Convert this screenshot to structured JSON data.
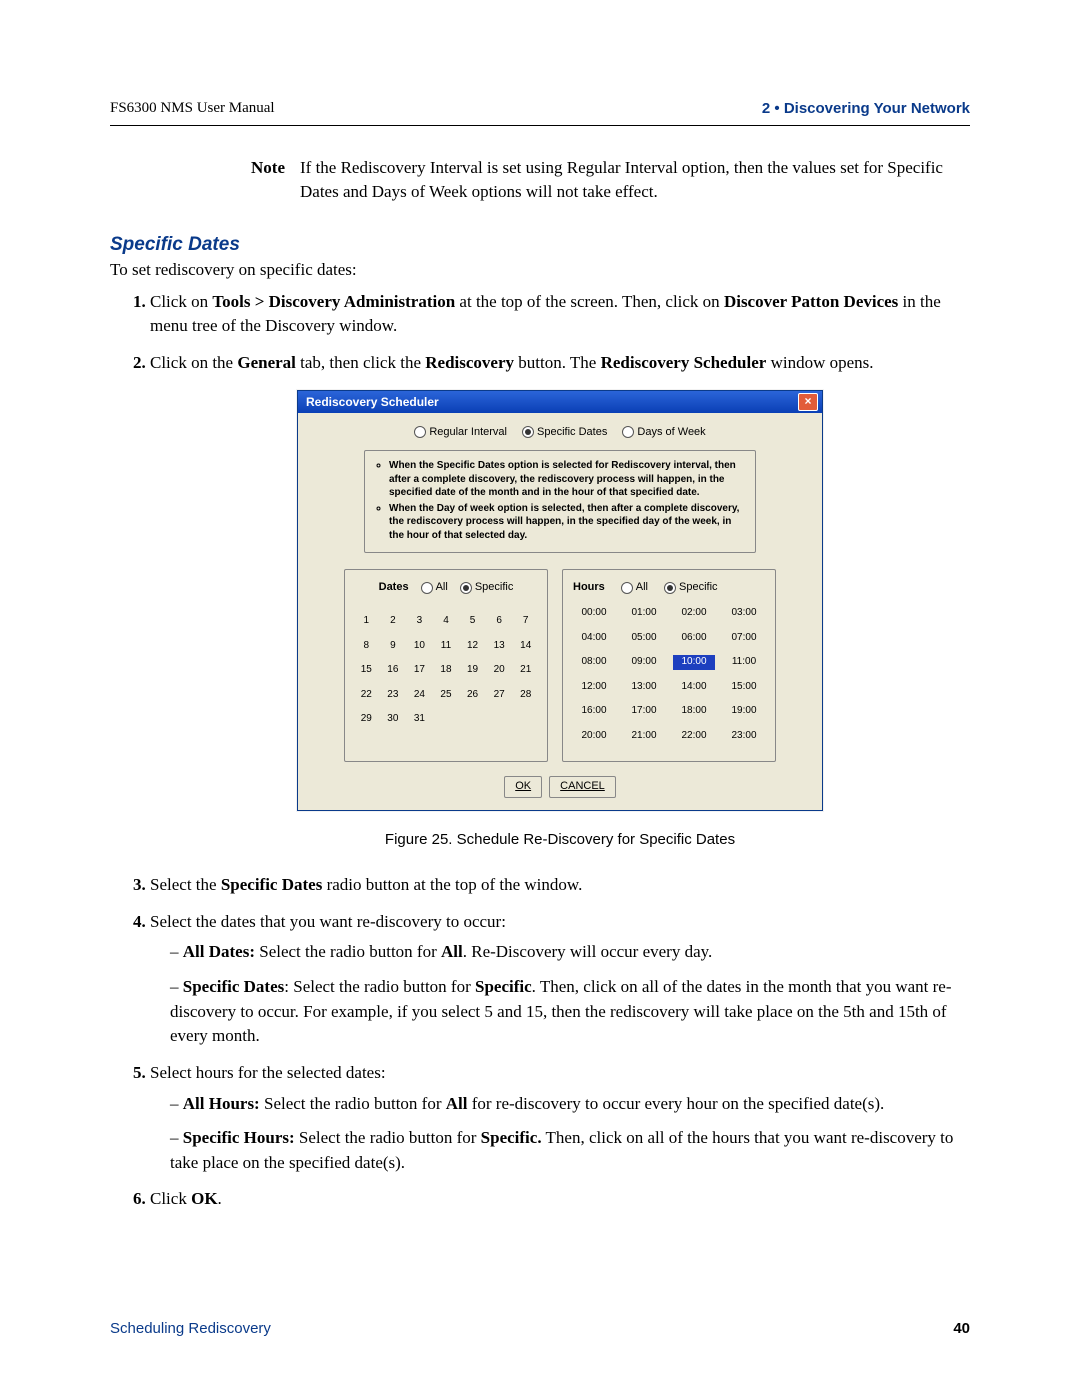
{
  "header": {
    "left": "FS6300 NMS User Manual",
    "right": "2 • Discovering Your Network"
  },
  "note": {
    "label": "Note",
    "text": "If the Rediscovery Interval is set using Regular Interval option, then the values set for Specific Dates and Days of Week options will not take effect."
  },
  "section_title": "Specific Dates",
  "intro": "To set rediscovery on specific dates:",
  "steps": {
    "s1_a": "Click on ",
    "s1_b": "Tools > Discovery Administration",
    "s1_c": " at the top of the screen. Then, click on ",
    "s1_d": "Discover Patton Devices",
    "s1_e": " in the menu tree of the Discovery window.",
    "s2_a": "Click on the ",
    "s2_b": "General",
    "s2_c": " tab, then click the ",
    "s2_d": "Rediscovery",
    "s2_e": " button. The ",
    "s2_f": "Rediscovery Scheduler",
    "s2_g": " window opens.",
    "s3_a": "Select the ",
    "s3_b": "Specific Dates",
    "s3_c": " radio button at the top of the window.",
    "s4": "Select the dates that you want re-discovery to occur:",
    "s4_all_a": "All Dates:",
    "s4_all_b": " Select the radio button for ",
    "s4_all_c": "All",
    "s4_all_d": ". Re-Discovery will occur every day.",
    "s4_sp_a": "Specific Dates",
    "s4_sp_b": ": Select the radio button for ",
    "s4_sp_c": "Specific",
    "s4_sp_d": ". Then, click on all of the dates in the month that you want re-discovery to occur. For example, if you select 5 and 15, then the rediscovery will take place on the 5th and 15th of every month.",
    "s5": "Select hours for the selected dates:",
    "s5_ah_a": "All Hours:",
    "s5_ah_b": " Select the radio button for ",
    "s5_ah_c": "All",
    "s5_ah_d": " for re-discovery to occur every hour on the specified date(s).",
    "s5_sh_a": "Specific Hours:",
    "s5_sh_b": " Select the radio button for ",
    "s5_sh_c": "Specific.",
    "s5_sh_d": " Then, click on all of the hours that you want re-discovery to take place on the specified date(s).",
    "s6_a": "Click ",
    "s6_b": "OK",
    "s6_c": "."
  },
  "figure_caption": "Figure 25. Schedule Re-Discovery for Specific Dates",
  "dialog": {
    "title": "Rediscovery Scheduler",
    "radios": {
      "regular": "Regular Interval",
      "specific": "Specific Dates",
      "days": "Days of Week"
    },
    "info1": "When the Specific Dates option is selected for Rediscovery interval, then after a complete discovery, the rediscovery process will happen, in the specified date of the month and in the hour of that specified date.",
    "info2": "When the Day of week option is selected, then after a complete discovery, the rediscovery process will happen, in the specified day of the week, in the hour of that selected day.",
    "dates_label": "Dates",
    "hours_label": "Hours",
    "all_label": "All",
    "specific_label": "Specific",
    "ok": "OK",
    "cancel": "CANCEL",
    "days": [
      "1",
      "2",
      "3",
      "4",
      "5",
      "6",
      "7",
      "8",
      "9",
      "10",
      "11",
      "12",
      "13",
      "14",
      "15",
      "16",
      "17",
      "18",
      "19",
      "20",
      "21",
      "22",
      "23",
      "24",
      "25",
      "26",
      "27",
      "28",
      "29",
      "30",
      "31"
    ],
    "hours": [
      "00:00",
      "01:00",
      "02:00",
      "03:00",
      "04:00",
      "05:00",
      "06:00",
      "07:00",
      "08:00",
      "09:00",
      "10:00",
      "11:00",
      "12:00",
      "13:00",
      "14:00",
      "15:00",
      "16:00",
      "17:00",
      "18:00",
      "19:00",
      "20:00",
      "21:00",
      "22:00",
      "23:00"
    ],
    "selected_hour": "10:00"
  },
  "footer": {
    "left": "Scheduling Rediscovery",
    "page": "40"
  }
}
